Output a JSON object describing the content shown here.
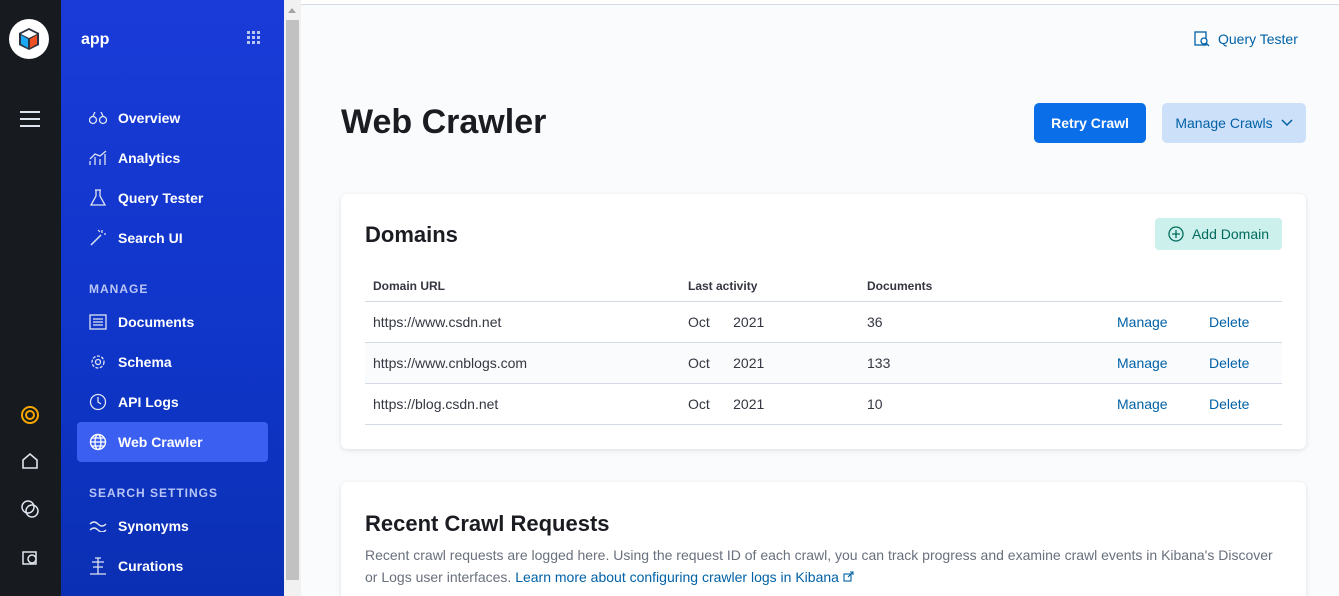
{
  "rail": {
    "icons": [
      "logo-icon",
      "menu-icon",
      "help-icon",
      "home-icon",
      "chat-icon",
      "settings-icon"
    ]
  },
  "nav": {
    "app_name": "app",
    "items": [
      {
        "label": "Overview",
        "icon": "binoculars-icon"
      },
      {
        "label": "Analytics",
        "icon": "analytics-icon"
      },
      {
        "label": "Query Tester",
        "icon": "beaker-icon"
      },
      {
        "label": "Search UI",
        "icon": "wand-icon"
      }
    ],
    "manage_heading": "MANAGE",
    "manage_items": [
      {
        "label": "Documents",
        "icon": "documents-icon"
      },
      {
        "label": "Schema",
        "icon": "gear-icon"
      },
      {
        "label": "API Logs",
        "icon": "clock-icon"
      },
      {
        "label": "Web Crawler",
        "icon": "globe-icon",
        "active": true
      }
    ],
    "search_settings_heading": "SEARCH SETTINGS",
    "search_items": [
      {
        "label": "Synonyms",
        "icon": "synonyms-icon"
      },
      {
        "label": "Curations",
        "icon": "curations-icon"
      }
    ]
  },
  "header": {
    "query_tester": "Query Tester",
    "title": "Web Crawler",
    "retry_crawl": "Retry Crawl",
    "manage_crawls": "Manage Crawls"
  },
  "domains": {
    "title": "Domains",
    "add_domain": "Add Domain",
    "columns": [
      "Domain URL",
      "Last activity",
      "Documents"
    ],
    "rows": [
      {
        "url": "https://www.csdn.net",
        "last_activity": "Oct      2021",
        "documents": "36",
        "manage": "Manage",
        "delete": "Delete"
      },
      {
        "url": "https://www.cnblogs.com",
        "last_activity": "Oct      2021",
        "documents": "133",
        "manage": "Manage",
        "delete": "Delete"
      },
      {
        "url": "https://blog.csdn.net",
        "last_activity": "Oct      2021",
        "documents": "10",
        "manage": "Manage",
        "delete": "Delete"
      }
    ]
  },
  "recent": {
    "title": "Recent Crawl Requests",
    "description": "Recent crawl requests are logged here. Using the request ID of each crawl, you can track progress and examine crawl events in Kibana's Discover or Logs user interfaces.",
    "link": "Learn more about configuring crawler logs in Kibana"
  },
  "colors": {
    "nav_blue": "#1a3bd8",
    "active_item": "#3b5ff0",
    "primary": "#0a6ee8",
    "link": "#0061a6",
    "success_bg": "#ccf0ec"
  }
}
